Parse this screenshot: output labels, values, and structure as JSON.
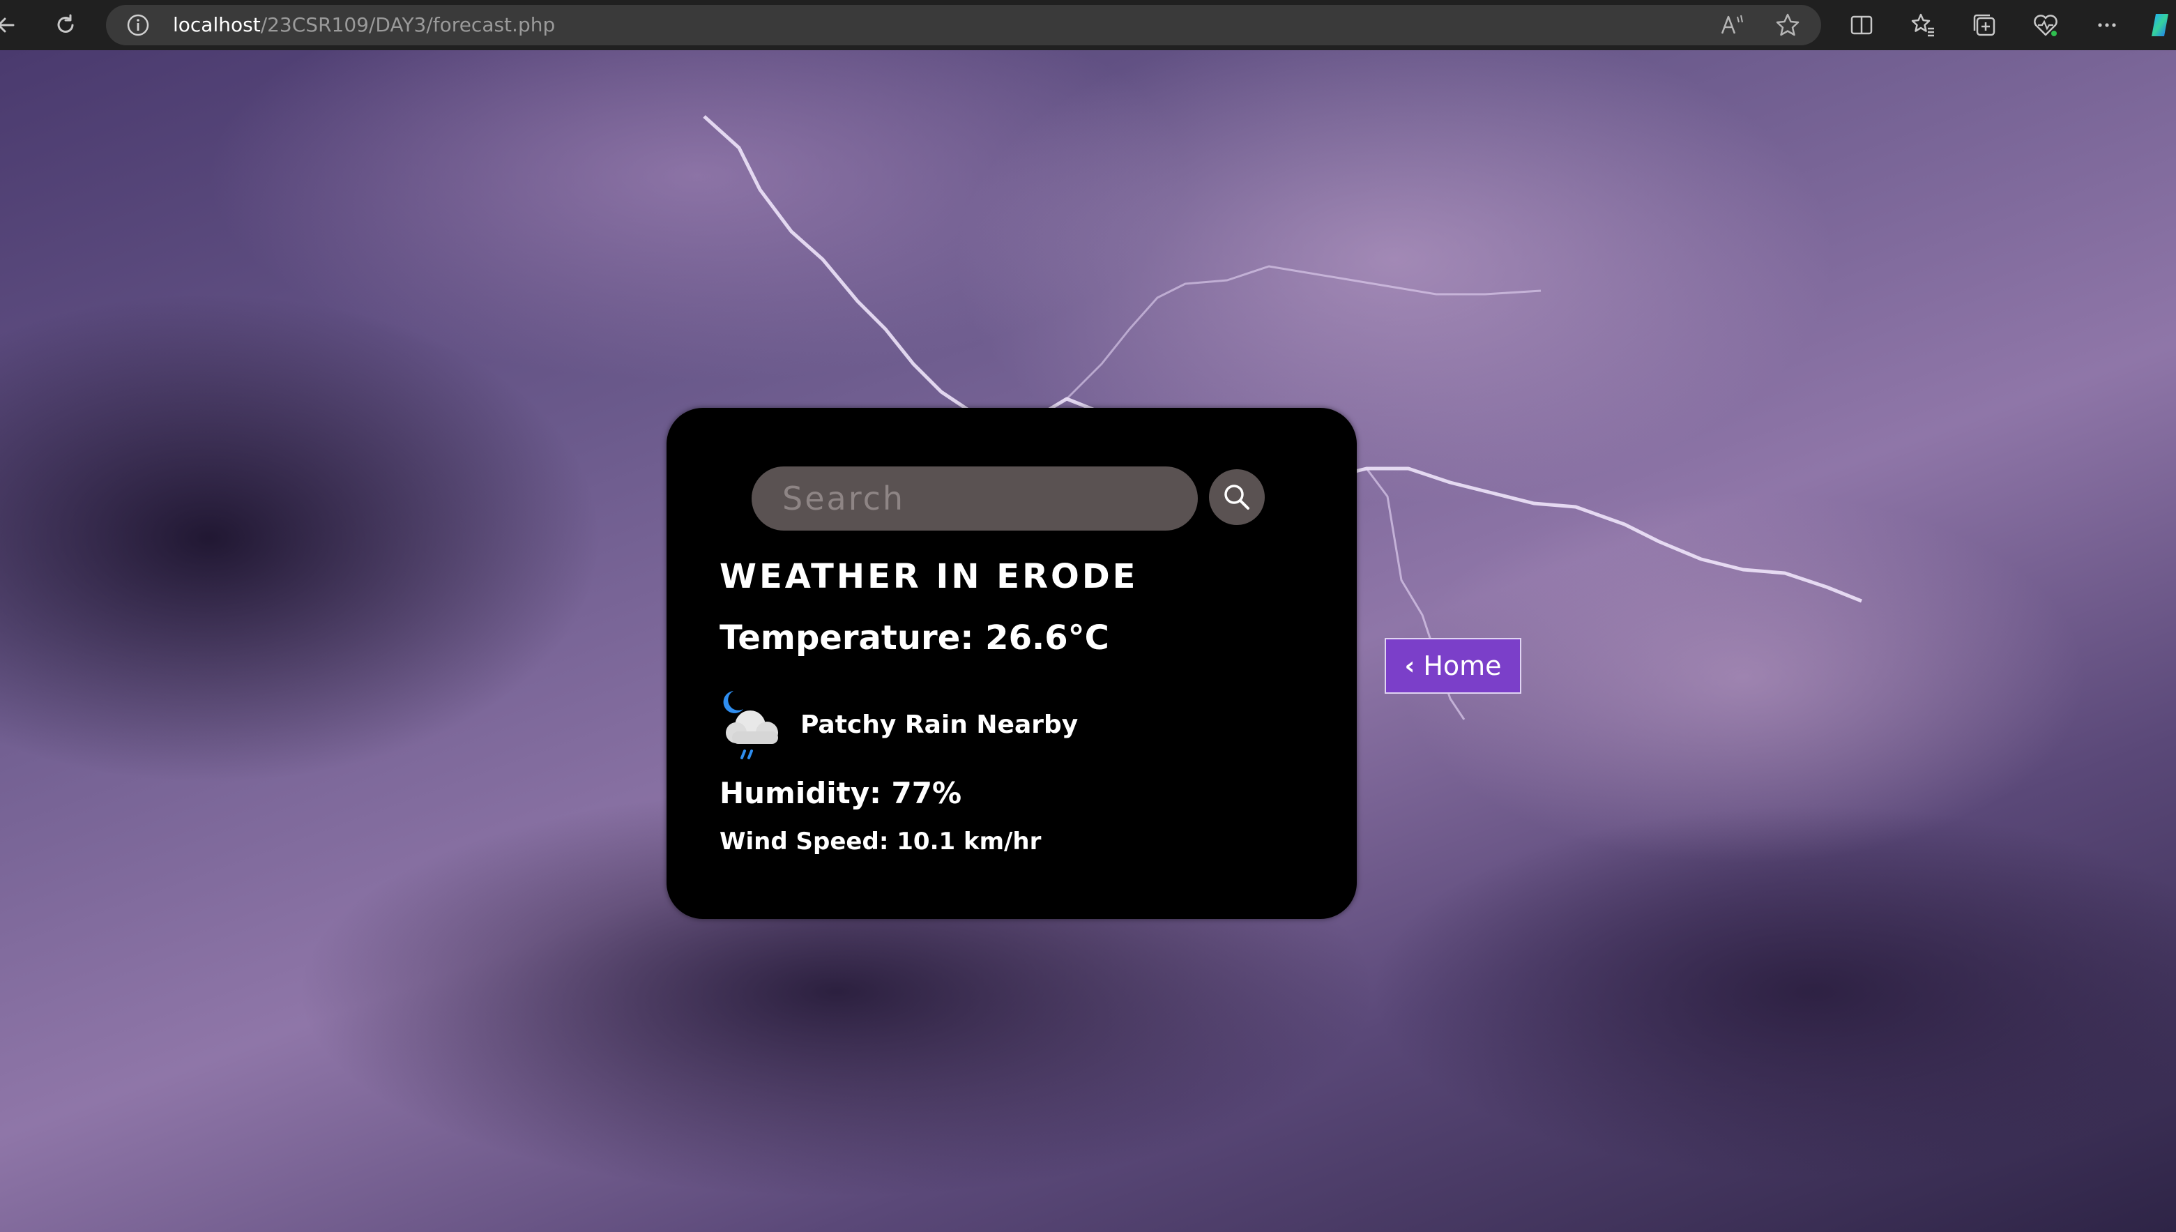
{
  "browser": {
    "url_host": "localhost",
    "url_path": "/23CSR109/DAY3/forecast.php",
    "colors": {
      "bar": "#202020",
      "address": "#3a3a3a",
      "icon": "#c8c8c8"
    },
    "icons": [
      "back-arrow-icon",
      "refresh-icon",
      "info-icon",
      "read-aloud-icon",
      "favorite-star-icon",
      "split-screen-icon",
      "favorites-icon",
      "collections-icon",
      "browser-essentials-icon",
      "more-options-icon",
      "copilot-icon"
    ]
  },
  "weather": {
    "search_placeholder": "Search",
    "title": "WEATHER IN ERODE",
    "temperature": "Temperature: 26.6°C",
    "condition": "Patchy Rain Nearby",
    "condition_icon": "moon-cloud-rain-icon",
    "humidity": "Humidity: 77%",
    "wind_speed": "Wind Speed: 10.1 km/hr"
  },
  "nav": {
    "home_chevron": "‹",
    "home_label": "Home"
  },
  "colors": {
    "card": "#000000",
    "search_field": "#5a5252",
    "home_button": "#7b3fc9",
    "text": "#ffffff"
  }
}
